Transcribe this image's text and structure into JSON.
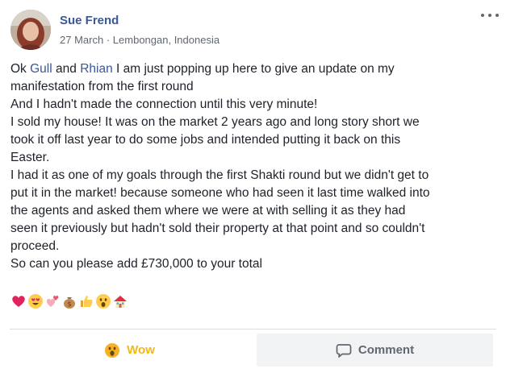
{
  "post": {
    "author": "Sue Frend",
    "date": "27 March",
    "separator": "·",
    "location": "Lembongan, Indonesia",
    "body_lines": [
      [
        {
          "t": "Ok "
        },
        {
          "t": "Gull",
          "m": true
        },
        {
          "t": " and "
        },
        {
          "t": "Rhian",
          "m": true
        },
        {
          "t": " I am just popping up here to give an update on my"
        }
      ],
      [
        {
          "t": "manifestation from the first round"
        }
      ],
      [
        {
          "t": "And I hadn't made the connection until this very minute!"
        }
      ],
      [
        {
          "t": "I sold my house! It was on the market 2 years ago and long story short we"
        }
      ],
      [
        {
          "t": "took it off last year to do some jobs and intended putting it back on this"
        }
      ],
      [
        {
          "t": "Easter."
        }
      ],
      [
        {
          "t": "I had it as one of my goals through the first Shakti round but we didn't get to"
        }
      ],
      [
        {
          "t": "put it in the market! because someone who had seen it last time walked into"
        }
      ],
      [
        {
          "t": "the agents and asked them where we were at with selling it as they had"
        }
      ],
      [
        {
          "t": "seen it previously but hadn't sold their property at that point and so couldn't"
        }
      ],
      [
        {
          "t": "proceed."
        }
      ],
      [
        {
          "t": "So can you please add £730,000 to your total"
        }
      ]
    ],
    "emoji_icons": [
      "heart-icon",
      "heart-eyes-icon",
      "two-hearts-icon",
      "money-bag-icon",
      "thumbs-up-icon",
      "wow-face-icon",
      "house-icon"
    ]
  },
  "actions": {
    "wow_label": "Wow",
    "comment_label": "Comment"
  },
  "colors": {
    "link": "#385898",
    "meta": "#616770",
    "wow": "#f0ba15",
    "comment_bg": "#f2f3f5"
  }
}
